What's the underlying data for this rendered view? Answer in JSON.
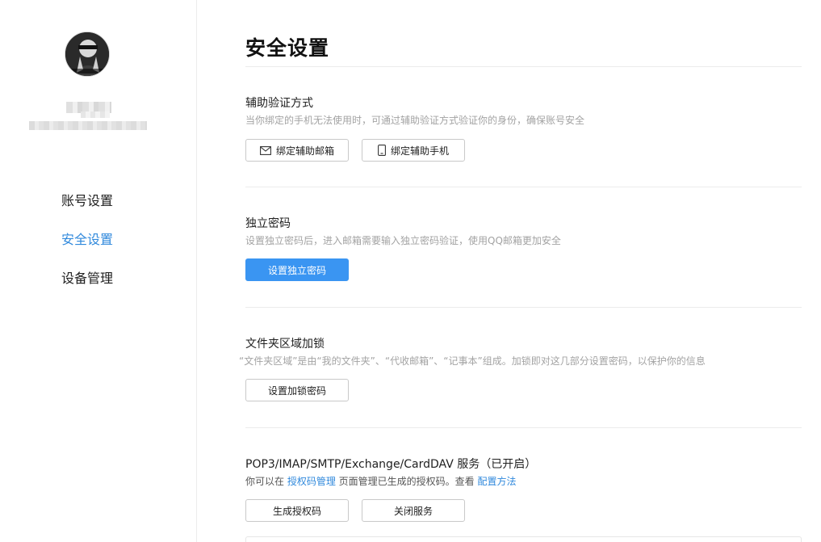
{
  "sidebar": {
    "nav": [
      {
        "label": "账号设置",
        "active": false
      },
      {
        "label": "安全设置",
        "active": true
      },
      {
        "label": "设备管理",
        "active": false
      }
    ]
  },
  "main": {
    "title": "安全设置",
    "sections": [
      {
        "title": "辅助验证方式",
        "desc": "当你绑定的手机无法使用时，可通过辅助验证方式验证你的身份，确保账号安全",
        "buttons": [
          {
            "label": "绑定辅助邮箱",
            "icon": "mail-icon"
          },
          {
            "label": "绑定辅助手机",
            "icon": "phone-icon"
          }
        ]
      },
      {
        "title": "独立密码",
        "desc": "设置独立密码后，进入邮箱需要输入独立密码验证，使用QQ邮箱更加安全",
        "buttons": [
          {
            "label": "设置独立密码",
            "primary": true
          }
        ]
      },
      {
        "title": "文件夹区域加锁",
        "desc": "“文件夹区域”是由“我的文件夹”、“代收邮箱”、“记事本”组成。加锁即对这几部分设置密码，以保护你的信息",
        "buttons": [
          {
            "label": "设置加锁密码"
          }
        ]
      },
      {
        "title": "POP3/IMAP/SMTP/Exchange/CardDAV 服务（已开启）",
        "desc_prefix": "你可以在 ",
        "desc_link1": "授权码管理",
        "desc_middle": " 页面管理已生成的授权码。查看 ",
        "desc_link2": "配置方法",
        "buttons": [
          {
            "label": "生成授权码"
          },
          {
            "label": "关闭服务"
          }
        ]
      }
    ]
  },
  "colors": {
    "accent": "#3089dc",
    "primary_button": "#3a95f2",
    "muted_text": "#a3a3a3"
  }
}
